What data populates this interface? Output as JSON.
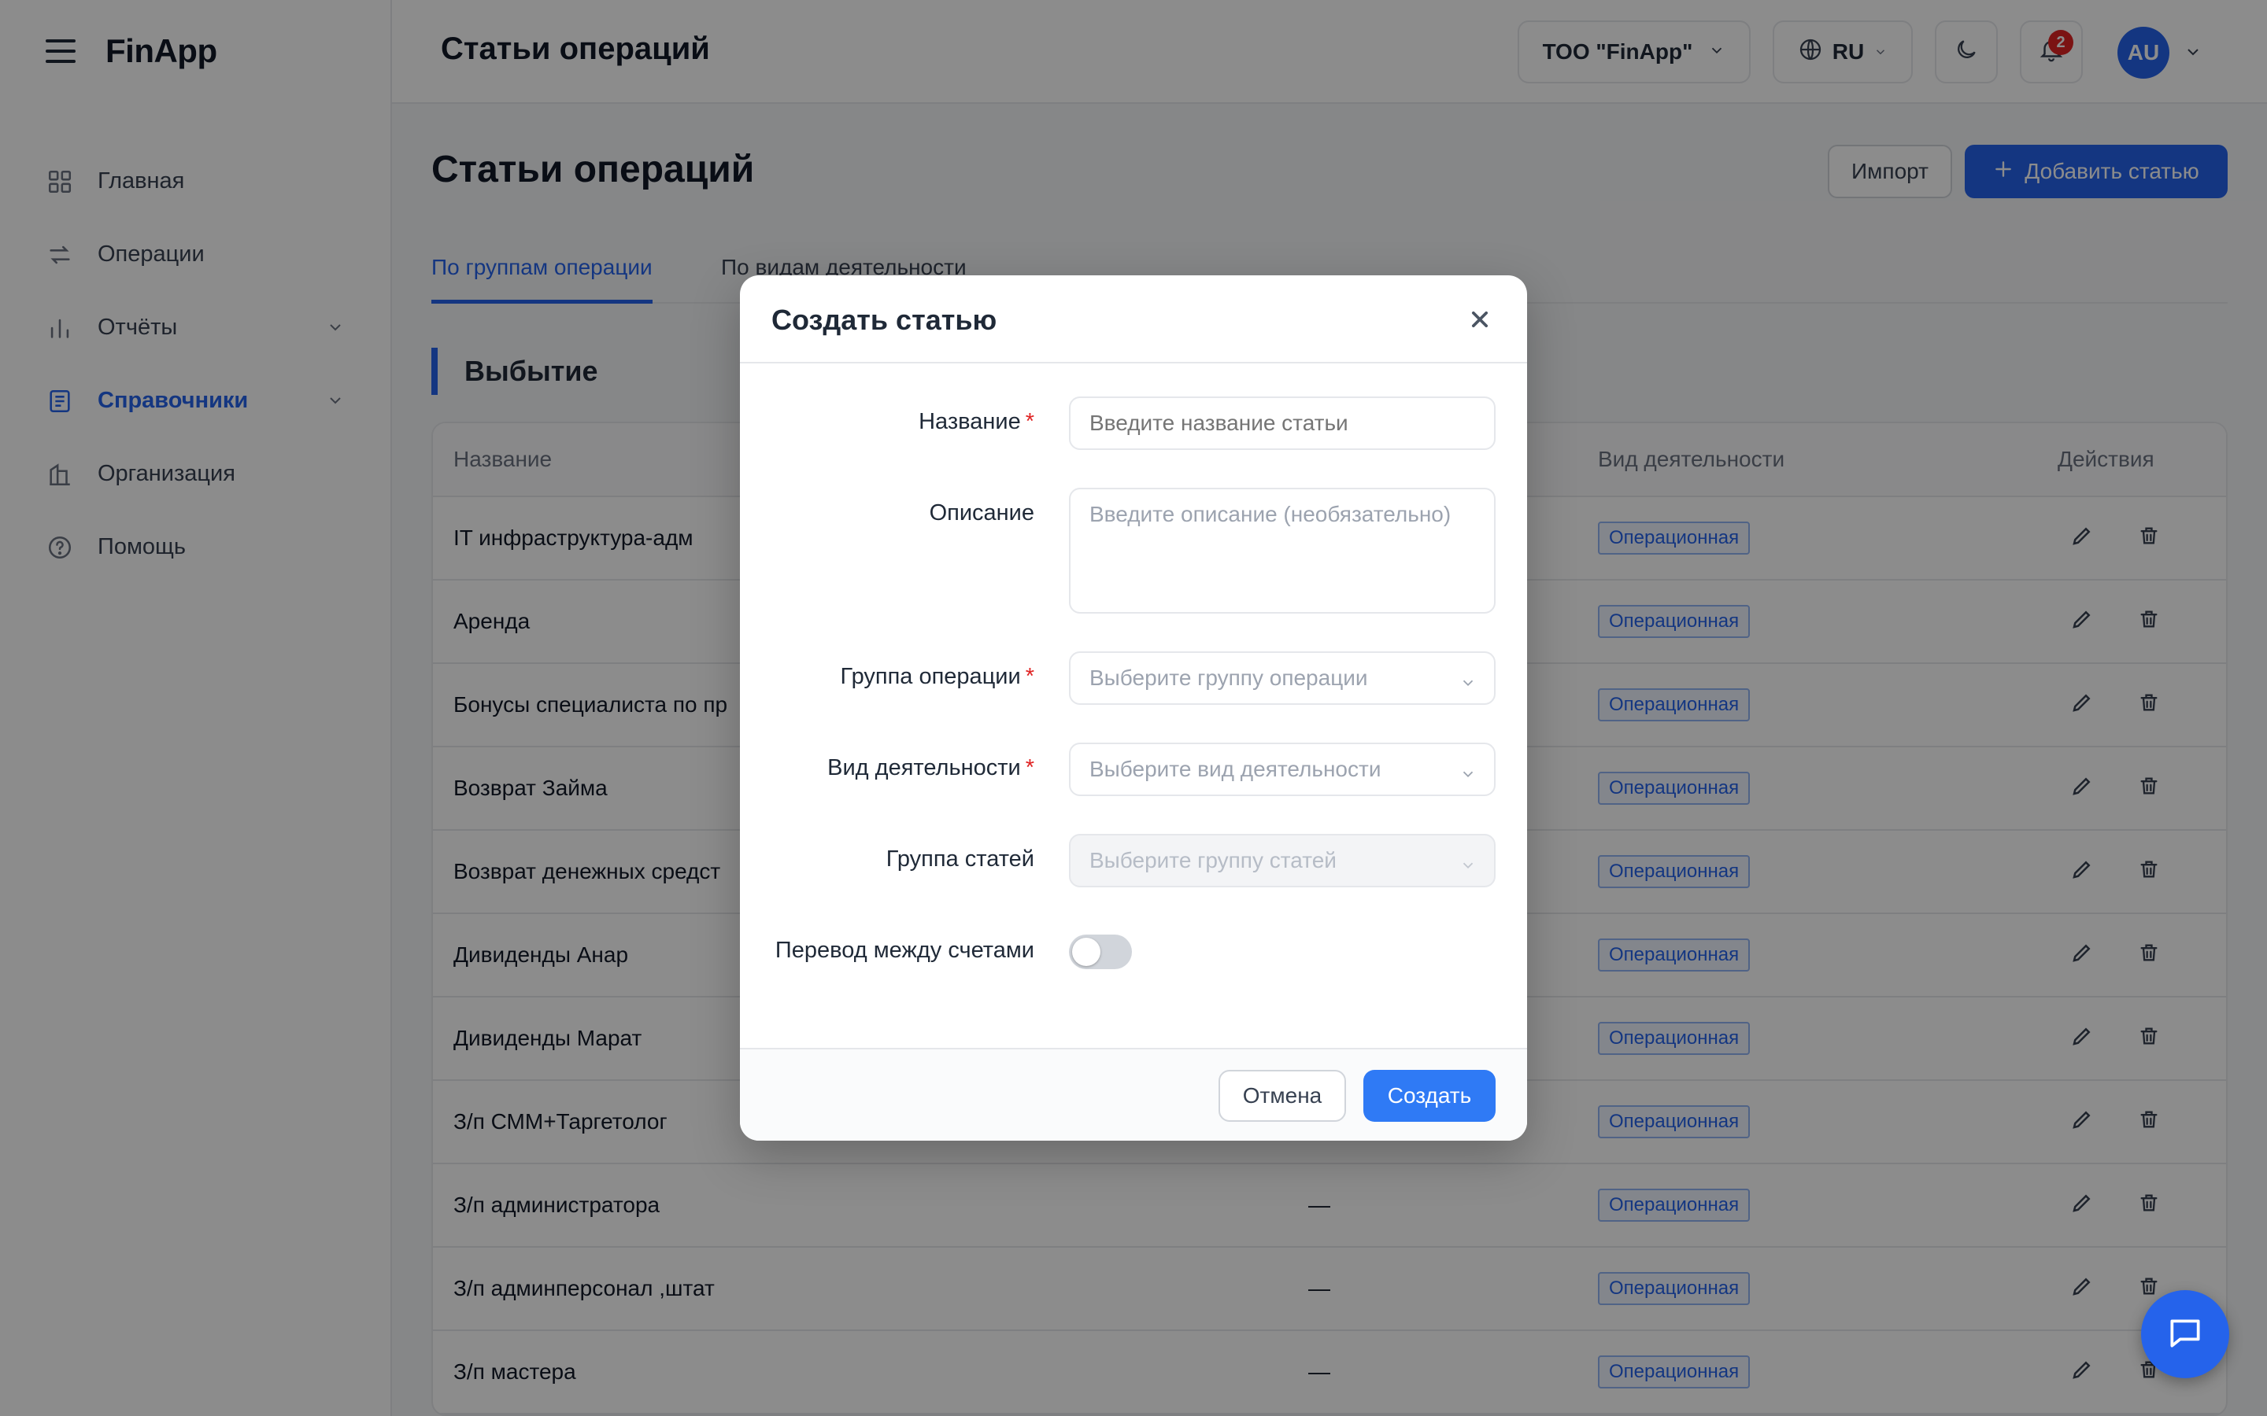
{
  "app": {
    "brand": "FinApp"
  },
  "sidebar": {
    "items": [
      {
        "label": "Главная",
        "icon": "grid-icon"
      },
      {
        "label": "Операции",
        "icon": "arrows-exchange-icon"
      },
      {
        "label": "Отчёты",
        "icon": "bar-chart-icon"
      },
      {
        "label": "Справочники",
        "icon": "book-icon"
      },
      {
        "label": "Организация",
        "icon": "building-icon"
      },
      {
        "label": "Помощь",
        "icon": "help-circle-icon"
      }
    ]
  },
  "topbar": {
    "title": "Статьи операций",
    "company": "ТОО \"FinApp\"",
    "language": "RU",
    "notifications_count": "2",
    "avatar_initials": "AU"
  },
  "main": {
    "title": "Статьи операций",
    "import_label": "Импорт",
    "add_label": "Добавить статью",
    "tabs": [
      "По группам операции",
      "По видам деятельности"
    ],
    "section_title": "Выбытие",
    "table": {
      "columns": {
        "name": "Название",
        "activity": "Вид деятельности",
        "actions": "Действия"
      },
      "rows": [
        {
          "name": "IT инфраструктура-адм",
          "group": "",
          "tag": "Операционная"
        },
        {
          "name": "Аренда",
          "group": "",
          "tag": "Операционная"
        },
        {
          "name": "Бонусы специалиста по пр",
          "group": "",
          "tag": "Операционная"
        },
        {
          "name": "Возврат Займа",
          "group": "",
          "tag": "Операционная"
        },
        {
          "name": "Возврат денежных средст",
          "group": "",
          "tag": "Операционная"
        },
        {
          "name": "Дивиденды Анар",
          "group": "",
          "tag": "Операционная"
        },
        {
          "name": "Дивиденды Марат",
          "group": "",
          "tag": "Операционная"
        },
        {
          "name": "З/п СММ+Таргетолог",
          "group": "",
          "tag": "Операционная"
        },
        {
          "name": "З/п администратора",
          "group": "—",
          "tag": "Операционная"
        },
        {
          "name": "З/п админперсонал ,штат",
          "group": "—",
          "tag": "Операционная"
        },
        {
          "name": "З/п мастера",
          "group": "—",
          "tag": "Операционная"
        }
      ]
    }
  },
  "modal": {
    "title": "Создать статью",
    "fields": {
      "name": {
        "label": "Название",
        "placeholder": "Введите название статьи"
      },
      "description": {
        "label": "Описание",
        "placeholder": "Введите описание (необязательно)"
      },
      "operation_group": {
        "label": "Группа операции",
        "placeholder": "Выберите группу операции"
      },
      "activity_type": {
        "label": "Вид деятельности",
        "placeholder": "Выберите вид деятельности"
      },
      "article_group": {
        "label": "Группа статей",
        "placeholder": "Выберите группу статей"
      },
      "transfer": {
        "label": "Перевод между счетами"
      }
    },
    "required_mark": "*",
    "cancel_label": "Отмена",
    "create_label": "Создать"
  },
  "colors": {
    "accent": "#2563eb",
    "danger": "#e02424"
  }
}
